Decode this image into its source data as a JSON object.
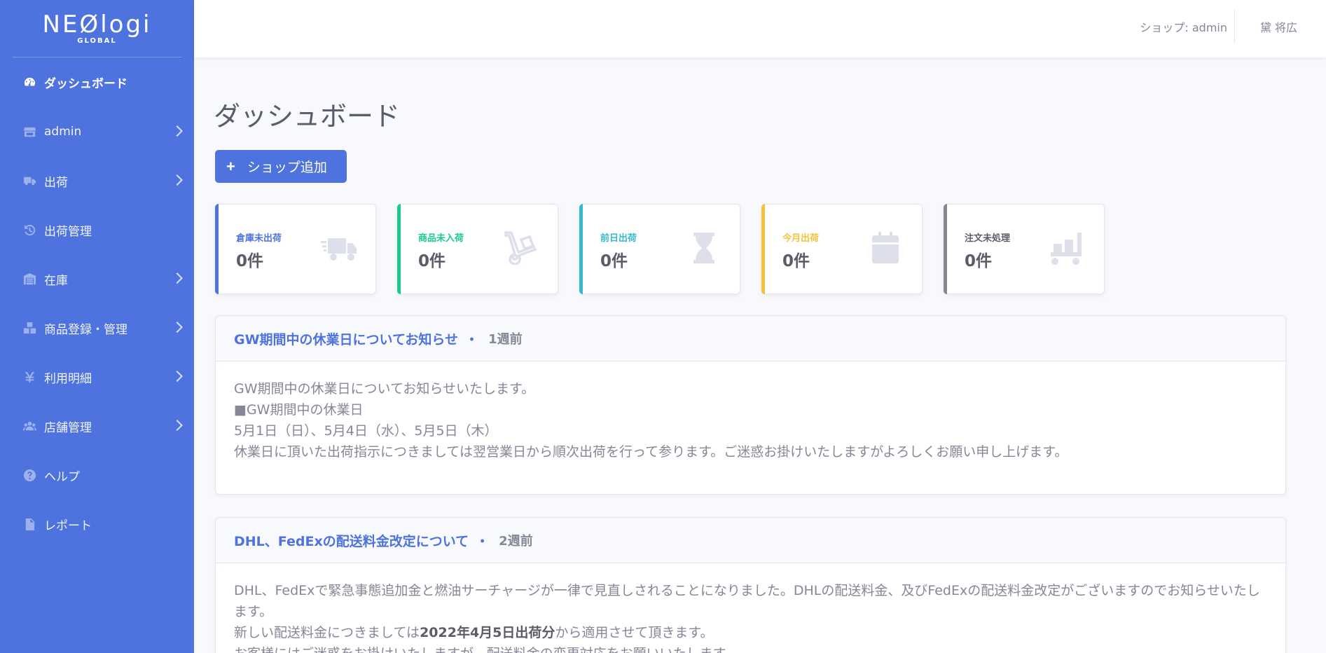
{
  "brand": {
    "name": "NEØlogi",
    "sub": "GLOBAL"
  },
  "sidebar": {
    "items": [
      {
        "label": "ダッシュボード",
        "icon": "tachometer-icon",
        "active": true,
        "chevron": false
      },
      {
        "label": "admin",
        "icon": "store-icon",
        "active": false,
        "chevron": true
      },
      {
        "label": "出荷",
        "icon": "truck-icon",
        "active": false,
        "chevron": true
      },
      {
        "label": "出荷管理",
        "icon": "history-icon",
        "active": false,
        "chevron": false
      },
      {
        "label": "在庫",
        "icon": "warehouse-icon",
        "active": false,
        "chevron": true
      },
      {
        "label": "商品登録・管理",
        "icon": "boxes-icon",
        "active": false,
        "chevron": true
      },
      {
        "label": "利用明細",
        "icon": "yen-icon",
        "active": false,
        "chevron": true
      },
      {
        "label": "店舗管理",
        "icon": "users-icon",
        "active": false,
        "chevron": true
      },
      {
        "label": "ヘルプ",
        "icon": "question-circle-icon",
        "active": false,
        "chevron": false
      },
      {
        "label": "レポート",
        "icon": "file-icon",
        "active": false,
        "chevron": false
      }
    ]
  },
  "topbar": {
    "shop": "ショップ: admin",
    "user": "黛 将広"
  },
  "main": {
    "title": "ダッシュボード",
    "add_shop": {
      "plus": "+",
      "label": "ショップ追加"
    }
  },
  "stats": [
    {
      "label": "倉庫未出荷",
      "value": "0件",
      "color": "#4e73df",
      "icon": "shipping-fast-icon"
    },
    {
      "label": "商品未入荷",
      "value": "0件",
      "color": "#1cc88a",
      "icon": "dolly-icon"
    },
    {
      "label": "前日出荷",
      "value": "0件",
      "color": "#36b9cc",
      "icon": "hourglass-icon"
    },
    {
      "label": "今月出荷",
      "value": "0件",
      "color": "#f6c23e",
      "icon": "calendar-icon"
    },
    {
      "label": "注文未処理",
      "value": "0件",
      "color": "#858796",
      "icon": "dolly-flatbed-icon"
    }
  ],
  "news": [
    {
      "title": "GW期間中の休業日についてお知らせ",
      "dot": "・",
      "time": "1週前",
      "lines": [
        "GW期間中の休業日についてお知らせいたします。",
        "■GW期間中の休業日",
        "5月1日（日）、5月4日（水）、5月5日（木）",
        "休業日に頂いた出荷指示につきましては翌営業日から順次出荷を行って参ります。ご迷惑お掛けいたしますがよろしくお願い申し上げます。"
      ]
    },
    {
      "title": "DHL、FedExの配送料金改定について",
      "dot": "・",
      "time": "2週前",
      "line1": "DHL、FedExで緊急事態追加金と燃油サーチャージが一律で見直しされることになりました。DHLの配送料金、及びFedExの配送料金改定がございますのでお知らせいたします。",
      "line2_pre": "新しい配送料金につきましては",
      "line2_bold": "2022年4月5日出荷分",
      "line2_post": "から適用させて頂きます。",
      "line3": "お客様にはご迷惑をお掛けいたしますが、配送料金の変更対応をお願いいたします。"
    }
  ]
}
